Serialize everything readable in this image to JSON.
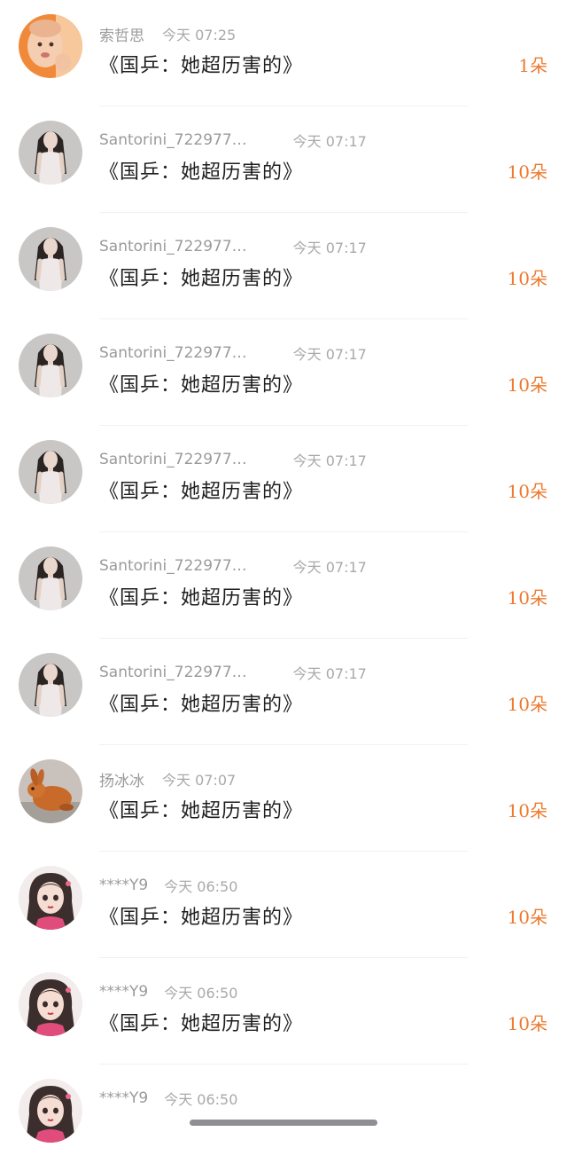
{
  "gifts": [
    {
      "name": "索哲思",
      "time": "今天 07:25",
      "message": "《国乒：她超历害的》",
      "amount": "1朵",
      "avatar": "baby-avatar"
    },
    {
      "name": "Santorini_722977…",
      "time": "今天 07:17",
      "message": "《国乒：她超历害的》",
      "amount": "10朵",
      "avatar": "woman-photo-avatar"
    },
    {
      "name": "Santorini_722977…",
      "time": "今天 07:17",
      "message": "《国乒：她超历害的》",
      "amount": "10朵",
      "avatar": "woman-photo-avatar"
    },
    {
      "name": "Santorini_722977…",
      "time": "今天 07:17",
      "message": "《国乒：她超历害的》",
      "amount": "10朵",
      "avatar": "woman-photo-avatar"
    },
    {
      "name": "Santorini_722977…",
      "time": "今天 07:17",
      "message": "《国乒：她超历害的》",
      "amount": "10朵",
      "avatar": "woman-photo-avatar"
    },
    {
      "name": "Santorini_722977…",
      "time": "今天 07:17",
      "message": "《国乒：她超历害的》",
      "amount": "10朵",
      "avatar": "woman-photo-avatar"
    },
    {
      "name": "Santorini_722977…",
      "time": "今天 07:17",
      "message": "《国乒：她超历害的》",
      "amount": "10朵",
      "avatar": "woman-photo-avatar"
    },
    {
      "name": "扬冰冰",
      "time": "今天 07:07",
      "message": "《国乒：她超历害的》",
      "amount": "10朵",
      "avatar": "rabbit-avatar"
    },
    {
      "name": "****Y9",
      "time": "今天 06:50",
      "message": "《国乒：她超历害的》",
      "amount": "10朵",
      "avatar": "cartoon-girl-avatar"
    },
    {
      "name": "****Y9",
      "time": "今天 06:50",
      "message": "《国乒：她超历害的》",
      "amount": "10朵",
      "avatar": "cartoon-girl-avatar"
    },
    {
      "name": "****Y9",
      "time": "今天 06:50",
      "message": "",
      "amount": "",
      "avatar": "cartoon-girl-avatar"
    }
  ],
  "colors": {
    "amount": "#ec7a2f",
    "name": "#9a9a9a",
    "message": "#1f1f1f"
  }
}
